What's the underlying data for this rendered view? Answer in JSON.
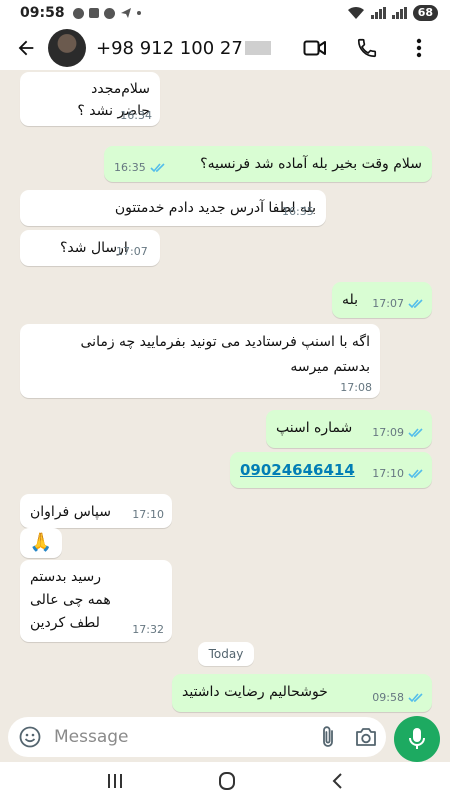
{
  "status_bar": {
    "time": "09:58",
    "battery": "68"
  },
  "header": {
    "contact_name": "+98 912 100 27"
  },
  "messages": [
    {
      "dir": "in",
      "text": "سلام‌مجدد\nحاضر نشد ؟",
      "time": "16:34"
    },
    {
      "dir": "out",
      "text": "سلام وقت بخیر بله آماده شد فرنسیه؟",
      "time": "16:35"
    },
    {
      "dir": "in",
      "text": "بله لطفا آدرس جدید دادم خدمتتون",
      "time": "16:35"
    },
    {
      "dir": "in",
      "text": "ارسال شد؟",
      "time": "17:07"
    },
    {
      "dir": "out",
      "text": "بله",
      "time": "17:07"
    },
    {
      "dir": "in",
      "text": "اگه با اسنپ فرستادید می تونید بفرمایید چه زمانی\nبدستم میرسه",
      "time": "17:08"
    },
    {
      "dir": "out",
      "text": "شماره اسنپ",
      "time": "17:09"
    },
    {
      "dir": "out",
      "text": "09024646414",
      "time": "17:10"
    },
    {
      "dir": "in",
      "text": "سپاس فراوان",
      "time": "17:10"
    },
    {
      "dir": "in",
      "text": "🙏",
      "time": ""
    },
    {
      "dir": "in",
      "text": "رسید بدستم\nهمه چی عالی\nلطف کردین",
      "time": "17:32"
    },
    {
      "dir": "out",
      "text": "خوشحالیم رضایت داشتید",
      "time": "09:58"
    }
  ],
  "day_divider": "Today",
  "input": {
    "placeholder": "Message"
  },
  "colors": {
    "incoming": "#ffffff",
    "outgoing": "#d9fdd3",
    "chat_bg": "#efeae2",
    "accent": "#1daa61",
    "read_ticks": "#53bdeb"
  },
  "icons": {
    "back": "arrow-left-icon",
    "video": "video-call-icon",
    "call": "phone-icon",
    "menu": "more-vert-icon",
    "emoji": "emoji-icon",
    "attach": "paperclip-icon",
    "camera": "camera-icon",
    "mic": "microphone-icon"
  }
}
